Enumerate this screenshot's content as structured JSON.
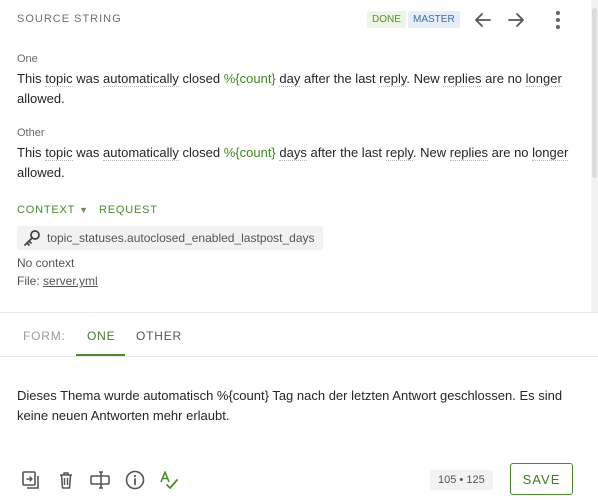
{
  "header": {
    "title": "SOURCE STRING",
    "badges": {
      "done": "DONE",
      "master": "MASTER"
    }
  },
  "plurals": [
    {
      "label": "One",
      "text": {
        "w1": "This",
        "w2": "topic",
        "w3": "was",
        "w4": "automatically",
        "w5": "closed",
        "ph": "%{count}",
        "w6": "day",
        "w7": "after the last",
        "w8": "reply",
        "w9": ". New",
        "w10": "replies",
        "w11": "are no",
        "w12": "longer",
        "w13": "allowed."
      }
    },
    {
      "label": "Other",
      "text": {
        "w1": "This",
        "w2": "topic",
        "w3": "was",
        "w4": "automatically",
        "w5": "closed",
        "ph": "%{count}",
        "w6": "days",
        "w7": "after the last",
        "w8": "reply",
        "w9": ". New",
        "w10": "replies",
        "w11": "are no",
        "w12": "longer",
        "w13": "allowed."
      }
    }
  ],
  "context": {
    "context_tab": "CONTEXT",
    "request_tab": "REQUEST",
    "key": "topic_statuses.autoclosed_enabled_lastpost_days",
    "no_context": "No context",
    "file_label": "File:",
    "file_name": "server.yml"
  },
  "form": {
    "label": "FORM:",
    "tabs": [
      "ONE",
      "OTHER"
    ],
    "active_tab": "ONE"
  },
  "translation": "Dieses Thema wurde automatisch %{count} Tag nach der letzten Antwort geschlossen. Es sind keine neuen Antworten mehr erlaubt.",
  "toolbar": {
    "icons": [
      "copy-source-icon",
      "delete-icon",
      "text-field-icon",
      "info-icon",
      "spellcheck-icon"
    ],
    "counter_current": "105",
    "counter_sep": "•",
    "counter_max": "125",
    "save_label": "SAVE"
  },
  "colors": {
    "accent": "#4a8a2c",
    "placeholder": "#3f8a1f",
    "done_badge_bg": "#edf5e4",
    "master_badge_bg": "#e5eef8"
  }
}
